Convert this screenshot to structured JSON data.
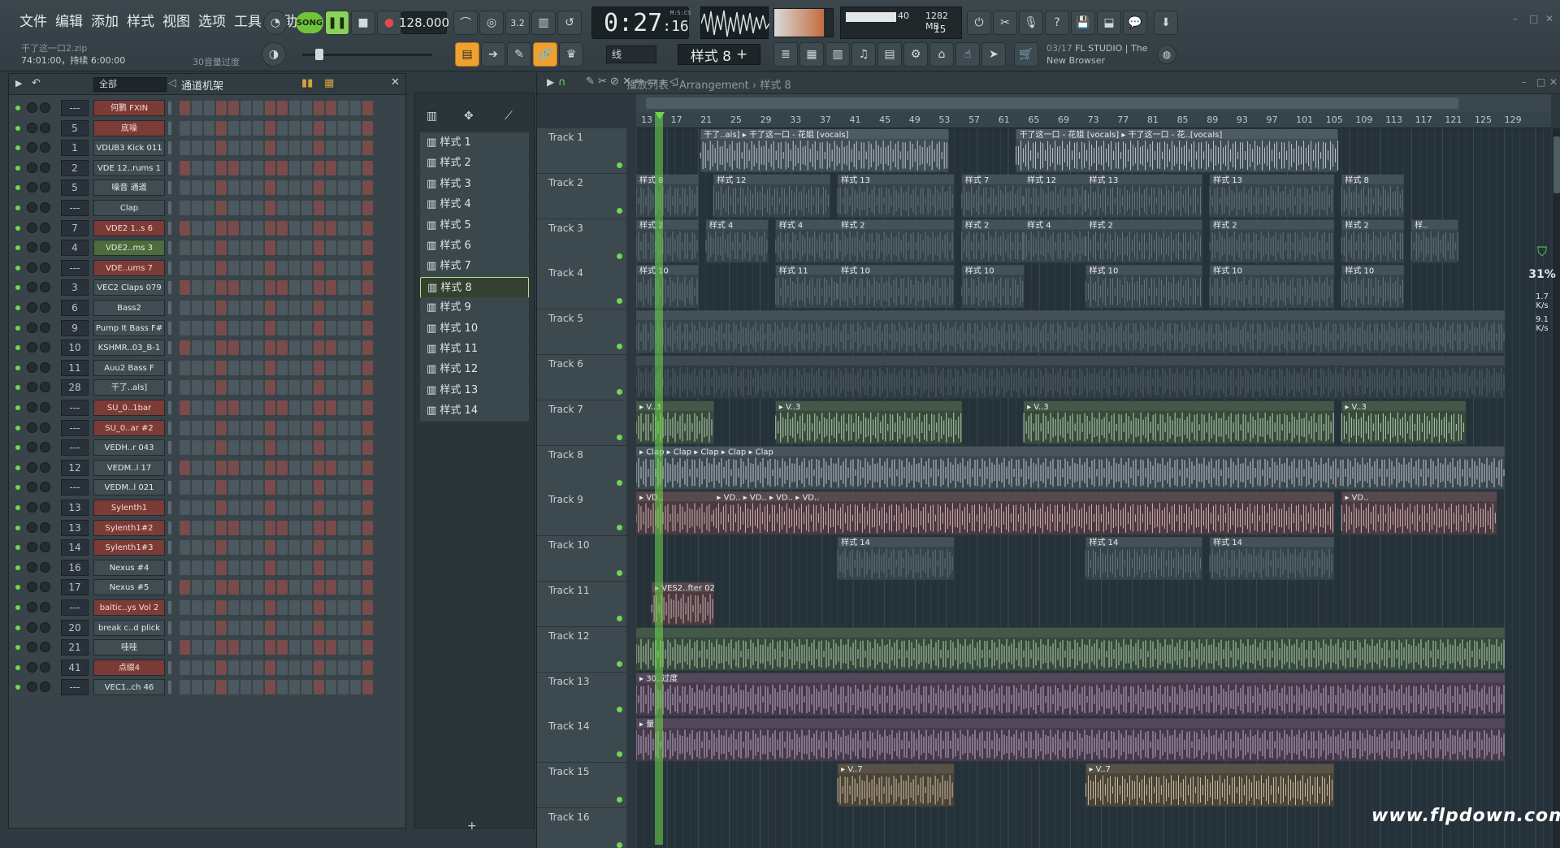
{
  "menu": [
    "文件",
    "编辑",
    "添加",
    "样式",
    "视图",
    "选项",
    "工具",
    "帮助"
  ],
  "transport": {
    "song_label": "SONG",
    "tempo": "128.000",
    "time_main": "0:27",
    "time_sub": ":16",
    "time_label": "M:S:CS"
  },
  "project": {
    "file": "干了这一口2.zip",
    "info": "74:01:00，持续 6:00:00",
    "undo_hint": "30音量过度"
  },
  "cpu": {
    "voices": "40",
    "memory": "1282 MB",
    "polyphony": "15"
  },
  "pattern_selector": "样式 8",
  "snap": "线",
  "news": {
    "date": "03/17",
    "line1": "FL STUDIO | The",
    "line2": "New Browser"
  },
  "rack": {
    "filter": "全部",
    "title": "通道机架",
    "channels": [
      {
        "num": "---",
        "name": "何鹏 FXIN",
        "style": "red"
      },
      {
        "num": "5",
        "name": "底噪",
        "style": "red"
      },
      {
        "num": "1",
        "name": "VDUB3 Kick 011",
        "style": "grey"
      },
      {
        "num": "2",
        "name": "VDE 12..rums 1",
        "style": "grey"
      },
      {
        "num": "5",
        "name": "噪音 通道",
        "style": "grey"
      },
      {
        "num": "---",
        "name": "Clap",
        "style": "grey"
      },
      {
        "num": "7",
        "name": "VDE2 1..s 6",
        "style": "red"
      },
      {
        "num": "4",
        "name": "VDE2..ms 3",
        "style": "green"
      },
      {
        "num": "---",
        "name": "VDE..ums 7",
        "style": "red"
      },
      {
        "num": "3",
        "name": "VEC2 Claps 079",
        "style": "grey"
      },
      {
        "num": "6",
        "name": "Bass2",
        "style": "grey"
      },
      {
        "num": "9",
        "name": "Pump It Bass F#",
        "style": "grey"
      },
      {
        "num": "10",
        "name": "KSHMR..03_B-1",
        "style": "grey"
      },
      {
        "num": "11",
        "name": "Auu2 Bass F",
        "style": "grey"
      },
      {
        "num": "28",
        "name": "干了..als]",
        "style": "grey"
      },
      {
        "num": "---",
        "name": "SU_0..1bar",
        "style": "red"
      },
      {
        "num": "---",
        "name": "SU_0..ar #2",
        "style": "red"
      },
      {
        "num": "---",
        "name": "VEDH..r 043",
        "style": "grey"
      },
      {
        "num": "12",
        "name": "VEDM..l 17",
        "style": "grey"
      },
      {
        "num": "---",
        "name": "VEDM..l 021",
        "style": "grey"
      },
      {
        "num": "13",
        "name": "Sylenth1",
        "style": "red"
      },
      {
        "num": "13",
        "name": "Sylenth1#2",
        "style": "red"
      },
      {
        "num": "14",
        "name": "Sylenth1#3",
        "style": "red"
      },
      {
        "num": "16",
        "name": "Nexus #4",
        "style": "grey"
      },
      {
        "num": "17",
        "name": "Nexus #5",
        "style": "grey"
      },
      {
        "num": "---",
        "name": "baltic..ys Vol 2",
        "style": "red"
      },
      {
        "num": "20",
        "name": "break c..d plick",
        "style": "grey"
      },
      {
        "num": "21",
        "name": "哇哇",
        "style": "grey"
      },
      {
        "num": "41",
        "name": "点缀4",
        "style": "red"
      },
      {
        "num": "---",
        "name": "VEC1..ch 46",
        "style": "grey"
      }
    ]
  },
  "patterns": [
    "样式 1",
    "样式 2",
    "样式 3",
    "样式 4",
    "样式 5",
    "样式 6",
    "样式 7",
    "样式 8",
    "样式 9",
    "样式 10",
    "样式 11",
    "样式 12",
    "样式 13",
    "样式 14"
  ],
  "active_pattern_index": 7,
  "playlist": {
    "crumb": "播放列表 - Arrangement › 样式 8",
    "ruler": [
      "13",
      "17",
      "21",
      "25",
      "29",
      "33",
      "37",
      "41",
      "45",
      "49",
      "53",
      "57",
      "61",
      "65",
      "69",
      "73",
      "77",
      "81",
      "85",
      "89",
      "93",
      "97",
      "101",
      "105",
      "109",
      "113",
      "117",
      "121",
      "125",
      "129"
    ],
    "tracks": [
      "Track 1",
      "Track 2",
      "Track 3",
      "Track 4",
      "Track 5",
      "Track 6",
      "Track 7",
      "Track 8",
      "Track 9",
      "Track 10",
      "Track 11",
      "Track 12",
      "Track 13",
      "Track 14",
      "Track 15",
      "Track 16"
    ],
    "clips": [
      {
        "t": 0,
        "bar": 9.3,
        "len": 32,
        "label": "干了..als] ▸ 干了这一口 - 花姐 [vocals]",
        "kind": "audio"
      },
      {
        "t": 0,
        "bar": 50,
        "len": 41.5,
        "label": "干了这一口 - 花姐 [vocals]  ▸ 干了这一口 - 花..[vocals]",
        "kind": "audio"
      },
      {
        "t": 1,
        "bar": 1,
        "len": 8,
        "label": "样式 8",
        "kind": "pat"
      },
      {
        "t": 1,
        "bar": 11,
        "len": 15,
        "label": "样式 12",
        "kind": "pat"
      },
      {
        "t": 1,
        "bar": 27,
        "len": 15,
        "label": "样式 13",
        "kind": "pat"
      },
      {
        "t": 1,
        "bar": 43,
        "len": 8,
        "label": "样式 7",
        "kind": "pat"
      },
      {
        "t": 1,
        "bar": 51,
        "len": 8,
        "label": "样式 12",
        "kind": "pat"
      },
      {
        "t": 1,
        "bar": 59,
        "len": 15,
        "label": "样式 13",
        "kind": "pat"
      },
      {
        "t": 1,
        "bar": 75,
        "len": 16,
        "label": "样式 13",
        "kind": "pat"
      },
      {
        "t": 1,
        "bar": 92,
        "len": 8,
        "label": "样式 8",
        "kind": "pat"
      },
      {
        "t": 2,
        "bar": 1,
        "len": 8,
        "label": "样式 2",
        "kind": "pat"
      },
      {
        "t": 2,
        "bar": 10,
        "len": 8,
        "label": "样式 4",
        "kind": "pat"
      },
      {
        "t": 2,
        "bar": 19,
        "len": 8,
        "label": "样式 4",
        "kind": "pat"
      },
      {
        "t": 2,
        "bar": 27,
        "len": 15,
        "label": "样式 2",
        "kind": "pat"
      },
      {
        "t": 2,
        "bar": 43,
        "len": 8,
        "label": "样式 2",
        "kind": "pat"
      },
      {
        "t": 2,
        "bar": 51,
        "len": 8,
        "label": "样式 4",
        "kind": "pat"
      },
      {
        "t": 2,
        "bar": 59,
        "len": 15,
        "label": "样式 2",
        "kind": "pat"
      },
      {
        "t": 2,
        "bar": 75,
        "len": 16,
        "label": "样式 2",
        "kind": "pat"
      },
      {
        "t": 2,
        "bar": 92,
        "len": 8,
        "label": "样式 2",
        "kind": "pat"
      },
      {
        "t": 2,
        "bar": 101,
        "len": 6,
        "label": "样..",
        "kind": "pat"
      },
      {
        "t": 3,
        "bar": 1,
        "len": 8,
        "label": "样式 10",
        "kind": "pat"
      },
      {
        "t": 3,
        "bar": 19,
        "len": 8,
        "label": "样式 11",
        "kind": "pat"
      },
      {
        "t": 3,
        "bar": 27,
        "len": 15,
        "label": "样式 10",
        "kind": "pat"
      },
      {
        "t": 3,
        "bar": 43,
        "len": 8,
        "label": "样式 10",
        "kind": "pat"
      },
      {
        "t": 3,
        "bar": 59,
        "len": 15,
        "label": "样式 10",
        "kind": "pat"
      },
      {
        "t": 3,
        "bar": 75,
        "len": 16,
        "label": "样式 10",
        "kind": "pat"
      },
      {
        "t": 3,
        "bar": 92,
        "len": 8,
        "label": "样式 10",
        "kind": "pat"
      },
      {
        "t": 4,
        "bar": 1,
        "len": 112,
        "label": "",
        "kind": "pat"
      },
      {
        "t": 5,
        "bar": 1,
        "len": 112,
        "label": "",
        "kind": "dark"
      },
      {
        "t": 6,
        "bar": 1,
        "len": 10,
        "label": "▸ V..3",
        "kind": "green"
      },
      {
        "t": 6,
        "bar": 19,
        "len": 24,
        "label": "▸ V..3",
        "kind": "green"
      },
      {
        "t": 6,
        "bar": 51,
        "len": 40,
        "label": "▸ V..3",
        "kind": "green"
      },
      {
        "t": 6,
        "bar": 92,
        "len": 16,
        "label": "▸ V..3",
        "kind": "green"
      },
      {
        "t": 7,
        "bar": 1,
        "len": 112,
        "label": "▸ Clap  ▸ Clap  ▸ Clap  ▸ Clap  ▸ Clap",
        "kind": "grey"
      },
      {
        "t": 8,
        "bar": 1,
        "len": 10,
        "label": "▸ VD..",
        "kind": "pink"
      },
      {
        "t": 8,
        "bar": 11,
        "len": 80,
        "label": "▸ VD..  ▸ VD..  ▸ VD..  ▸ VD..",
        "kind": "pink"
      },
      {
        "t": 8,
        "bar": 92,
        "len": 20,
        "label": "▸ VD..",
        "kind": "pink"
      },
      {
        "t": 9,
        "bar": 27,
        "len": 15,
        "label": "样式 14",
        "kind": "pat"
      },
      {
        "t": 9,
        "bar": 59,
        "len": 15,
        "label": "样式 14",
        "kind": "pat"
      },
      {
        "t": 9,
        "bar": 75,
        "len": 16,
        "label": "样式 14",
        "kind": "pat"
      },
      {
        "t": 10,
        "bar": 3,
        "len": 8,
        "label": "▸ VES2..fter 02",
        "kind": "pink"
      },
      {
        "t": 11,
        "bar": 1,
        "len": 112,
        "label": "",
        "kind": "green"
      },
      {
        "t": 12,
        "bar": 1,
        "len": 112,
        "label": "▸ 30..过度",
        "kind": "purple"
      },
      {
        "t": 13,
        "bar": 1,
        "len": 112,
        "label": "▸ 量",
        "kind": "purple"
      },
      {
        "t": 14,
        "bar": 27,
        "len": 15,
        "label": "▸ V..7",
        "kind": "orange"
      },
      {
        "t": 14,
        "bar": 59,
        "len": 32,
        "label": "▸ V..7",
        "kind": "orange"
      }
    ]
  },
  "right_stats": {
    "cpu_pct": "31",
    "in": "1.7",
    "out": "9.1",
    "unit": "K/s"
  },
  "watermark": "www.flpdown.com"
}
